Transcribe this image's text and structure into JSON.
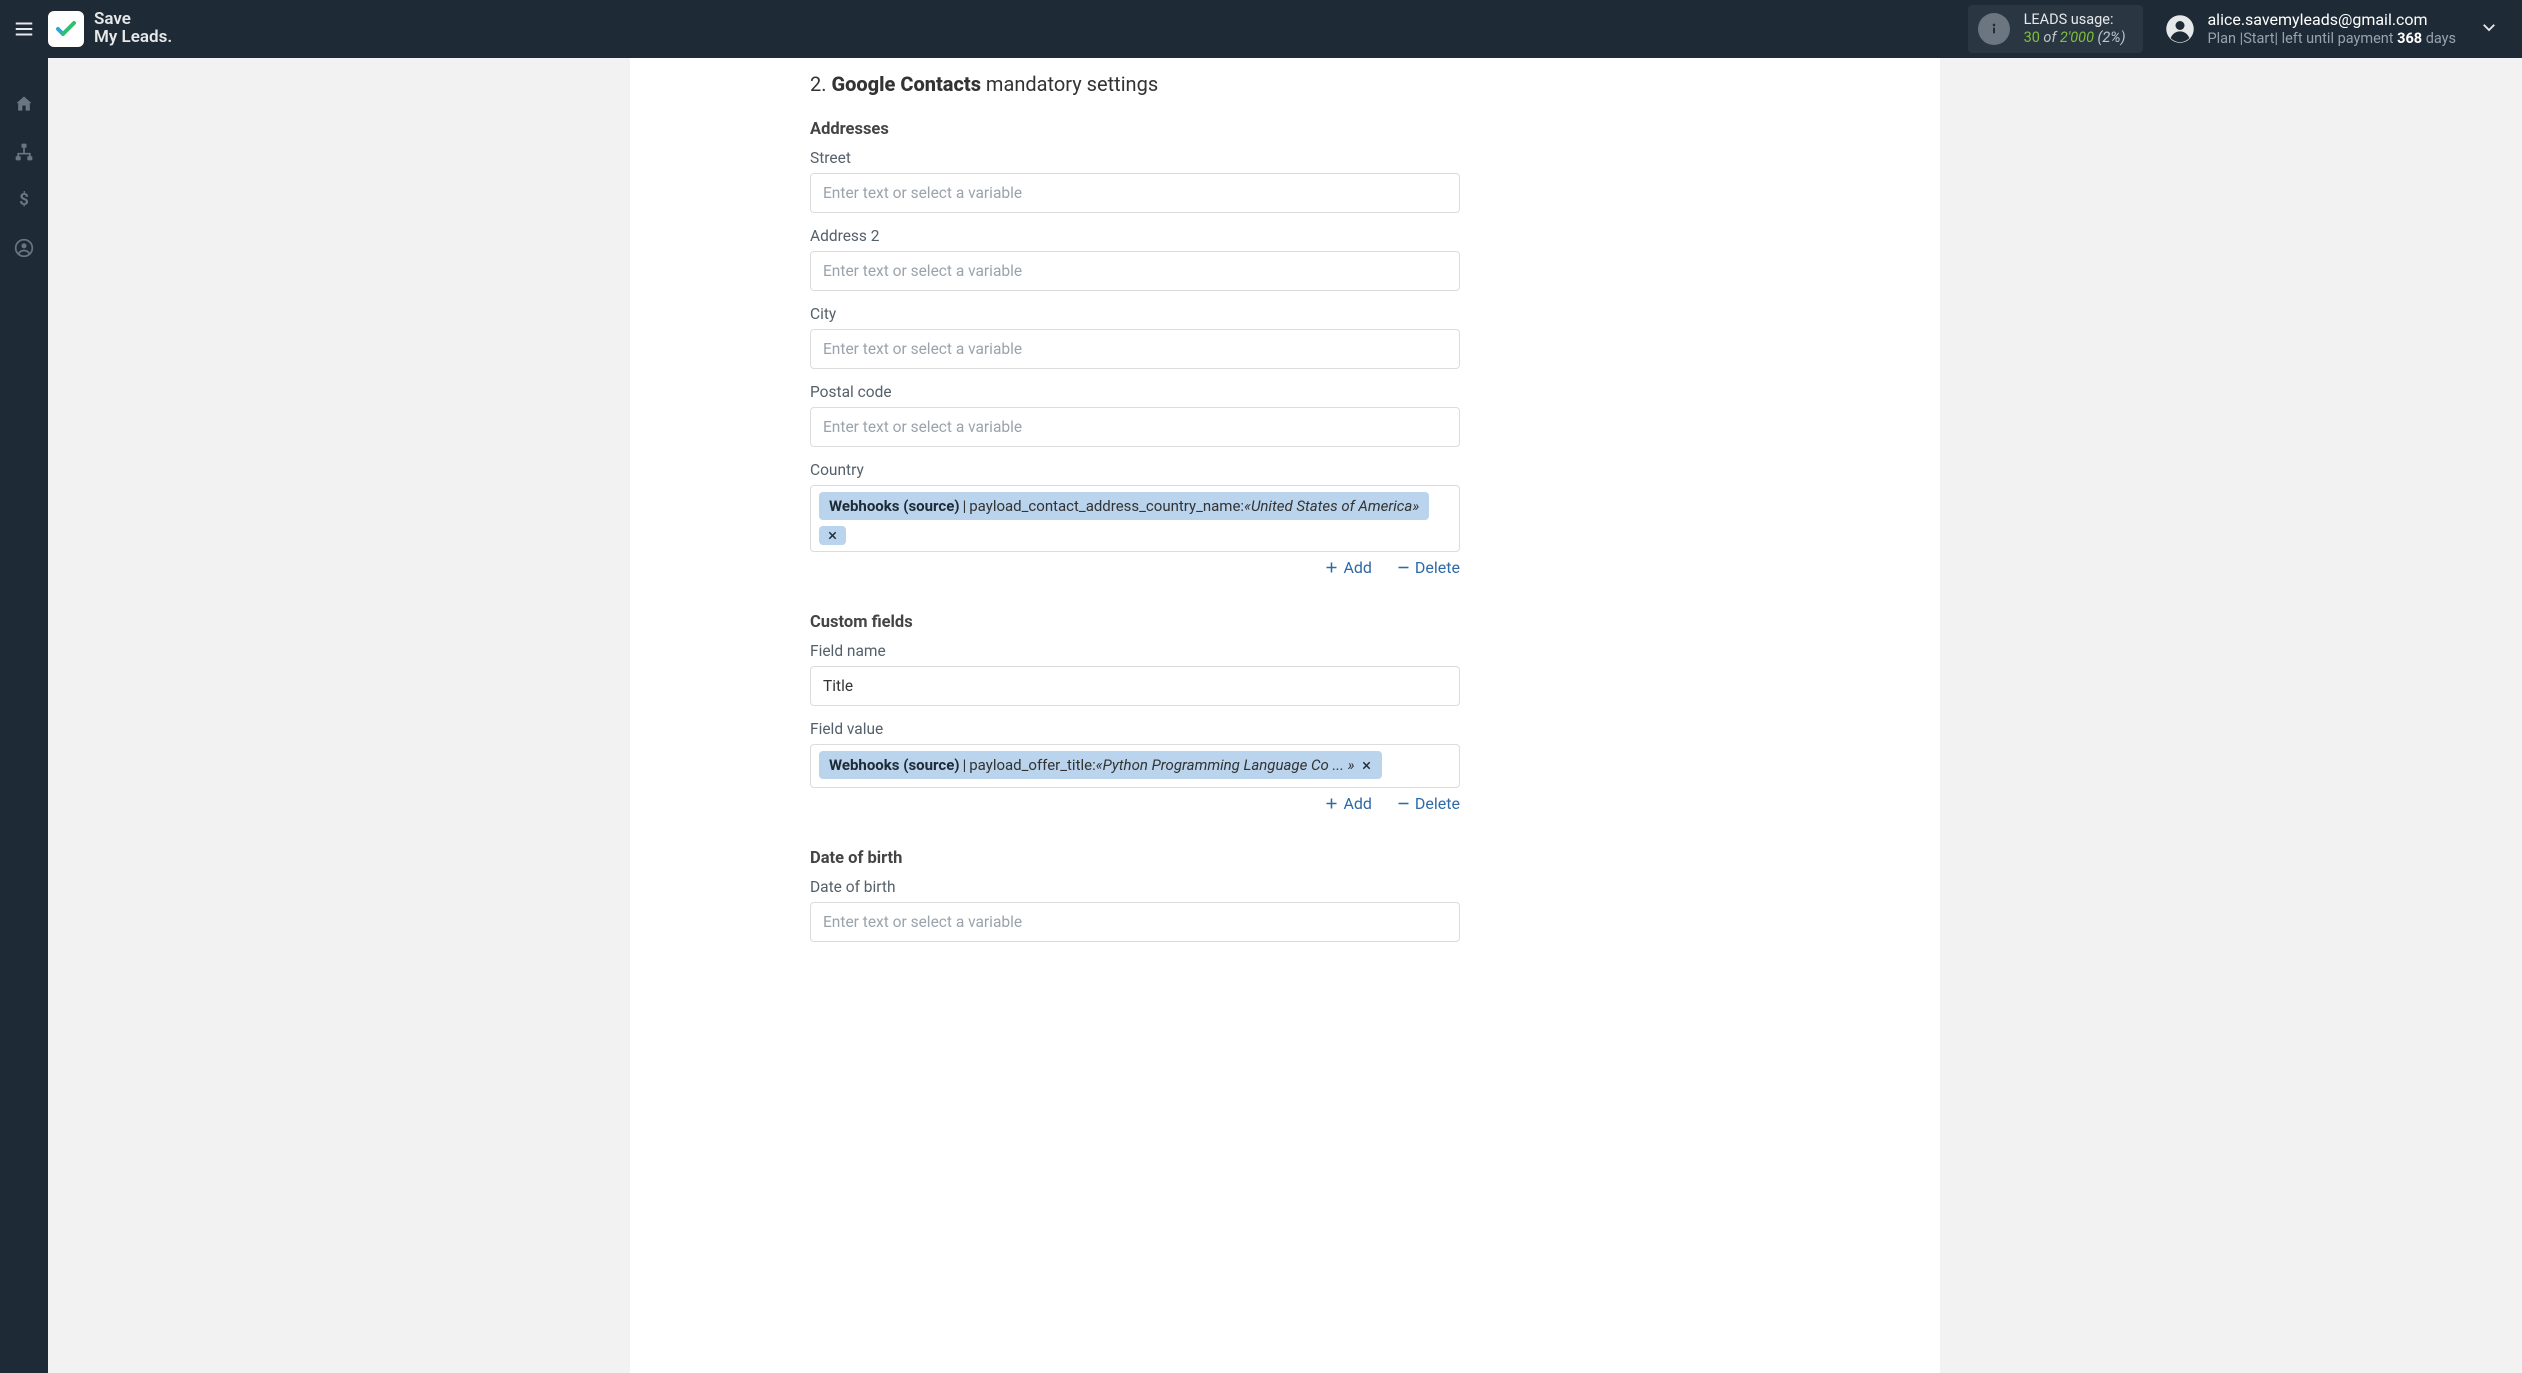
{
  "brand_line1": "Save",
  "brand_line2": "My Leads.",
  "usage": {
    "label": "LEADS usage:",
    "used": "30",
    "of": " of",
    "total": "2'000",
    "pct": "(2%)"
  },
  "account": {
    "email": "alice.savemyleads@gmail.com",
    "plan_prefix": "Plan |",
    "plan_name": "Start",
    "plan_mid": "| left until payment ",
    "days": "368",
    "days_suffix": " days"
  },
  "section": {
    "num": "2. ",
    "bold": "Google Contacts",
    "rest": " mandatory settings"
  },
  "addresses_heading": "Addresses",
  "fields": {
    "street": {
      "label": "Street",
      "placeholder": "Enter text or select a variable"
    },
    "address2": {
      "label": "Address 2",
      "placeholder": "Enter text or select a variable"
    },
    "city": {
      "label": "City",
      "placeholder": "Enter text or select a variable"
    },
    "postal": {
      "label": "Postal code",
      "placeholder": "Enter text or select a variable"
    },
    "country": {
      "label": "Country"
    },
    "dob": {
      "label": "Date of birth",
      "placeholder": "Enter text or select a variable"
    }
  },
  "country_tag": {
    "source": "Webhooks (source)",
    "key": "payload_contact_address_country_name: ",
    "value": "«United States of America»"
  },
  "custom_fields_heading": "Custom fields",
  "custom": {
    "name_label": "Field name",
    "name_value": "Title",
    "value_label": "Field value"
  },
  "value_tag": {
    "source": "Webhooks (source)",
    "key": "payload_offer_title: ",
    "value": "«Python Programming Language Co ... »"
  },
  "dob_heading": "Date of birth",
  "actions": {
    "add": "Add",
    "delete": "Delete"
  }
}
